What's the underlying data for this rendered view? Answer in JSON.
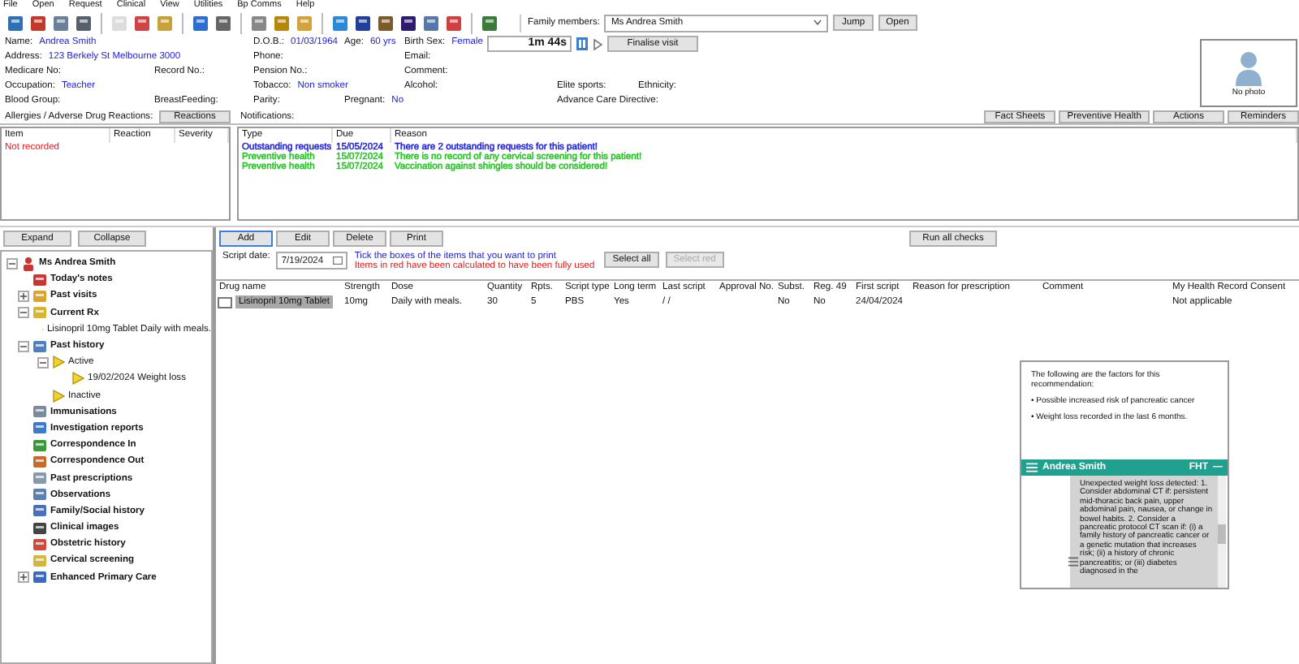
{
  "menu": [
    "File",
    "Open",
    "Request",
    "Clinical",
    "View",
    "Utilities",
    "Bp Comms",
    "Help"
  ],
  "family": {
    "label": "Family members:",
    "value": "Ms Andrea Smith",
    "buttons": [
      "Jump",
      "Open"
    ]
  },
  "timer": {
    "time": "1m 44s",
    "finalise": "Finalise visit"
  },
  "patient": {
    "name": {
      "label": "Name:",
      "value": "Andrea Smith"
    },
    "dob": {
      "label": "D.O.B.:",
      "value": "01/03/1964"
    },
    "age": {
      "label": "Age:",
      "value": "60 yrs"
    },
    "birth_sex": {
      "label": "Birth Sex:",
      "value": "Female"
    },
    "address": {
      "label": "Address:",
      "value": "123 Berkely St  Melbourne  3000"
    },
    "phone": {
      "label": "Phone:"
    },
    "email": {
      "label": "Email:"
    },
    "medicare_no": {
      "label": "Medicare No:"
    },
    "record_no": {
      "label": "Record No.:"
    },
    "pension_no": {
      "label": "Pension No.:"
    },
    "comment": {
      "label": "Comment:"
    },
    "occupation": {
      "label": "Occupation:",
      "value": "Teacher"
    },
    "tobacco": {
      "label": "Tobacco:",
      "value": "Non smoker"
    },
    "alcohol": {
      "label": "Alcohol:"
    },
    "elite_sports": {
      "label": "Elite sports:"
    },
    "ethnicity": {
      "label": "Ethnicity:"
    },
    "blood_group": {
      "label": "Blood Group:"
    },
    "breastfeeding": {
      "label": "BreastFeeding:"
    },
    "parity": {
      "label": "Parity:"
    },
    "pregnant": {
      "label": "Pregnant:",
      "value": "No"
    },
    "advance_care_directive": {
      "label": "Advance Care Directive:"
    }
  },
  "photo": {
    "caption": "No photo"
  },
  "allergies": {
    "title": "Allergies / Adverse Drug Reactions:",
    "button": "Reactions",
    "columns": [
      "Item",
      "Reaction",
      "Severity"
    ],
    "empty_text": "Not recorded"
  },
  "notifications": {
    "title": "Notifications:",
    "columns": [
      "Type",
      "Due",
      "Reason"
    ],
    "rows": [
      {
        "type": "Outstanding requests",
        "due": "15/05/2024",
        "reason": "There are 2 outstanding requests for this patient!",
        "color": "#1a1adf"
      },
      {
        "type": "Preventive health",
        "due": "15/07/2024",
        "reason": "There is no record of any cervical screening for this patient!",
        "color": "#1fc41f"
      },
      {
        "type": "Preventive health",
        "due": "15/07/2024",
        "reason": "Vaccination against shingles should be considered!",
        "color": "#1fc41f"
      }
    ]
  },
  "side_buttons": [
    "Fact Sheets",
    "Preventive Health",
    "Actions",
    "Reminders"
  ],
  "tree_buttons": [
    "Expand",
    "Collapse"
  ],
  "tree": {
    "label": "Ms Andrea Smith",
    "expanded": true,
    "children": [
      {
        "label": "Today's notes"
      },
      {
        "label": "Past visits",
        "expanded": false
      },
      {
        "label": "Current Rx",
        "expanded": true,
        "children": [
          {
            "label": "Lisinopril 10mg Tablet Daily with meals."
          }
        ]
      },
      {
        "label": "Past history",
        "expanded": true,
        "children": [
          {
            "label": "Active",
            "expanded": true,
            "children": [
              {
                "label": "19/02/2024  Weight loss"
              }
            ]
          },
          {
            "label": "Inactive"
          }
        ]
      },
      {
        "label": "Immunisations"
      },
      {
        "label": "Investigation reports"
      },
      {
        "label": "Correspondence In"
      },
      {
        "label": "Correspondence Out"
      },
      {
        "label": "Past prescriptions"
      },
      {
        "label": "Observations"
      },
      {
        "label": "Family/Social history"
      },
      {
        "label": "Clinical images"
      },
      {
        "label": "Obstetric history"
      },
      {
        "label": "Cervical screening"
      },
      {
        "label": "Enhanced Primary Care",
        "expanded": false
      }
    ]
  },
  "rx": {
    "buttons": [
      {
        "label": "Add",
        "selected": true
      },
      {
        "label": "Edit",
        "selected": false
      },
      {
        "label": "Delete",
        "selected": false
      },
      {
        "label": "Print",
        "selected": false
      }
    ],
    "run_checks": "Run all checks",
    "script_date": {
      "label": "Script date:",
      "value": "7/19/2024"
    },
    "hint": "Tick the boxes of the items that you want to print",
    "warning": "Items in red have been calculated to have been fully used",
    "select_all": {
      "label": "Select all",
      "disabled": false
    },
    "select_red": {
      "label": "Select red",
      "disabled": true
    },
    "columns": [
      "Drug name",
      "Strength",
      "Dose",
      "Quantity",
      "Rpts.",
      "Script type",
      "Long term",
      "Last script",
      "Approval No.",
      "Subst.",
      "Reg. 49",
      "First script",
      "Reason for prescription",
      "Comment",
      "My Health Record Consent"
    ],
    "rows": [
      {
        "checked": false,
        "selected": true,
        "cells": [
          "Lisinopril 10mg Tablet",
          "10mg",
          "Daily with meals.",
          "30",
          "5",
          "PBS",
          "Yes",
          "/  /",
          "",
          "No",
          "No",
          "24/04/2024",
          "",
          "",
          "Not applicable"
        ]
      }
    ]
  },
  "popup": {
    "intro": "The following are the factors for this recommendation:",
    "factors": [
      "• Possible increased risk of pancreatic cancer",
      "• Weight loss recorded in the last 6 months."
    ],
    "name": "Andrea Smith",
    "badge": "FHT",
    "minimize": "—",
    "message": "Unexpected weight loss detected: 1. Consider abdominal CT if: persistent mid-thoracic back pain, upper abdominal pain, nausea, or change in bowel habits. 2. Consider a pancreatic protocol CT scan if: (i) a family history of pancreatic cancer or a genetic mutation that increases risk; (ii) a history of chronic pancreatitis; or (iii) diabetes diagnosed in the"
  }
}
